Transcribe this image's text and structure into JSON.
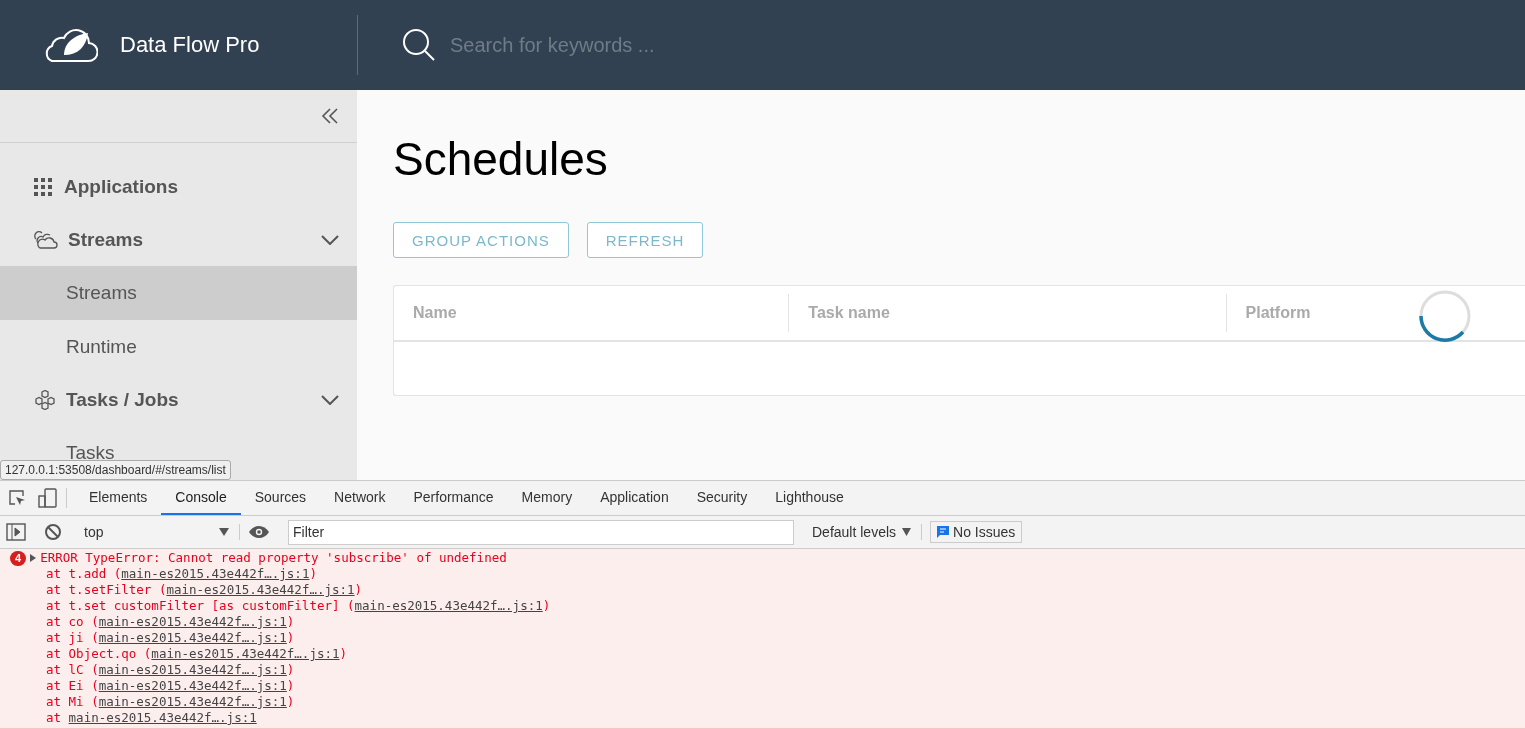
{
  "header": {
    "app_name": "Data Flow Pro",
    "search": {
      "placeholder": "Search for keywords ..."
    }
  },
  "sidebar": {
    "items": [
      {
        "kind": "group",
        "label": "Applications"
      },
      {
        "kind": "group",
        "label": "Streams",
        "expanded": true,
        "children": [
          {
            "label": "Streams",
            "selected": true
          },
          {
            "label": "Runtime",
            "selected": false
          }
        ]
      },
      {
        "kind": "group",
        "label": "Tasks / Jobs",
        "expanded": true,
        "children": [
          {
            "label": "Tasks",
            "selected": false
          }
        ]
      }
    ]
  },
  "page": {
    "title": "Schedules",
    "buttons": [
      "GROUP ACTIONS",
      "REFRESH"
    ],
    "table": {
      "columns": [
        "Name",
        "Task name",
        "Platform"
      ],
      "loading": true
    }
  },
  "status_url": "127.0.0.1:53508/dashboard/#/streams/list",
  "devtools": {
    "tabs": [
      {
        "label": "Elements",
        "selected": false
      },
      {
        "label": "Console",
        "selected": true
      },
      {
        "label": "Sources",
        "selected": false
      },
      {
        "label": "Network",
        "selected": false
      },
      {
        "label": "Performance",
        "selected": false
      },
      {
        "label": "Memory",
        "selected": false
      },
      {
        "label": "Application",
        "selected": false
      },
      {
        "label": "Security",
        "selected": false
      },
      {
        "label": "Lighthouse",
        "selected": false
      }
    ],
    "context": "top",
    "filter": {
      "placeholder": "Filter"
    },
    "levels": "Default levels",
    "issues": "No Issues",
    "error": {
      "count": "4",
      "message": "ERROR TypeError: Cannot read property 'subscribe' of undefined",
      "stack": [
        {
          "before": "at t.add (",
          "link": "main-es2015.43e442f….js:1",
          "after": ")"
        },
        {
          "before": "at t.setFilter (",
          "link": "main-es2015.43e442f….js:1",
          "after": ")"
        },
        {
          "before": "at t.set customFilter [as customFilter] (",
          "link": "main-es2015.43e442f….js:1",
          "after": ")"
        },
        {
          "before": "at co (",
          "link": "main-es2015.43e442f….js:1",
          "after": ")"
        },
        {
          "before": "at ji (",
          "link": "main-es2015.43e442f….js:1",
          "after": ")"
        },
        {
          "before": "at Object.qo (",
          "link": "main-es2015.43e442f….js:1",
          "after": ")"
        },
        {
          "before": "at lC (",
          "link": "main-es2015.43e442f….js:1",
          "after": ")"
        },
        {
          "before": "at Ei (",
          "link": "main-es2015.43e442f….js:1",
          "after": ")"
        },
        {
          "before": "at Mi (",
          "link": "main-es2015.43e442f….js:1",
          "after": ")"
        },
        {
          "before": "at ",
          "link": "main-es2015.43e442f….js:1"
        }
      ]
    }
  }
}
